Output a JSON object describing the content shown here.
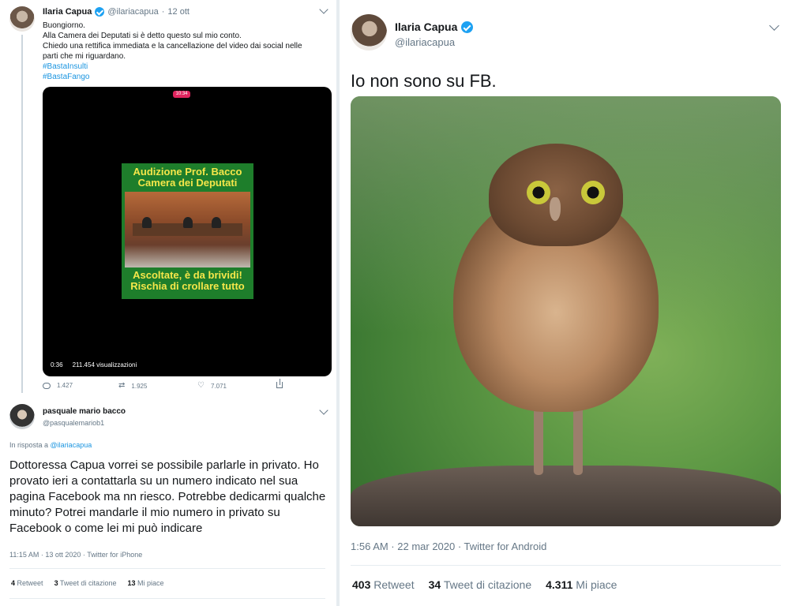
{
  "tweet1": {
    "author_name": "Ilaria Capua",
    "handle": "@ilariacapua",
    "date": "12 ott",
    "lines": [
      "Buongiorno.",
      "Alla Camera dei Deputati si è detto questo sul mio conto.",
      "Chiedo una rettifica immediata e la cancellazione del video dai social nelle",
      "parti che mi riguardano."
    ],
    "hashtags": [
      "#BastaInsulti",
      "#BastaFango"
    ],
    "video": {
      "badge": "10:34",
      "title_line1": "Audizione Prof. Bacco",
      "title_line2": "Camera dei Deputati",
      "subtitle_line1": "Ascoltate, è da brividi!",
      "subtitle_line2": "Rischia di crollare tutto",
      "duration": "0:36",
      "views": "211.454 visualizzazioni"
    },
    "actions": {
      "replies": "1.427",
      "retweets": "1.925",
      "likes": "7.071"
    }
  },
  "tweet2": {
    "author_name": "pasquale mario bacco",
    "handle": "@pasqualemariob1",
    "reply_prefix": "In risposta a",
    "reply_to": "@ilariacapua",
    "body": "Dottoressa Capua vorrei se possibile parlarle in privato. Ho provato ieri a contattarla su un numero indicato nel sua pagina Facebook ma nn riesco. Potrebbe dedicarmi qualche minuto? Potrei mandarle il mio numero in privato su Facebook o come lei mi può indicare",
    "meta": "11:15 AM · 13 ott 2020 · Twitter for iPhone",
    "stats": {
      "retweets_count": "4",
      "retweets_label": "Retweet",
      "quotes_count": "3",
      "quotes_label": "Tweet di citazione",
      "likes_count": "13",
      "likes_label": "Mi piace"
    }
  },
  "tweet3": {
    "author_name": "Ilaria Capua",
    "handle": "@ilariacapua",
    "text": "Io non sono su FB.",
    "meta": "1:56 AM · 22 mar 2020 · Twitter for Android",
    "stats": {
      "retweets_count": "403",
      "retweets_label": "Retweet",
      "quotes_count": "34",
      "quotes_label": "Tweet di citazione",
      "likes_count": "4.311",
      "likes_label": "Mi piace"
    }
  },
  "colors": {
    "link": "#1b95e0",
    "verified": "#1da1f2",
    "secondary_text": "#657786"
  }
}
